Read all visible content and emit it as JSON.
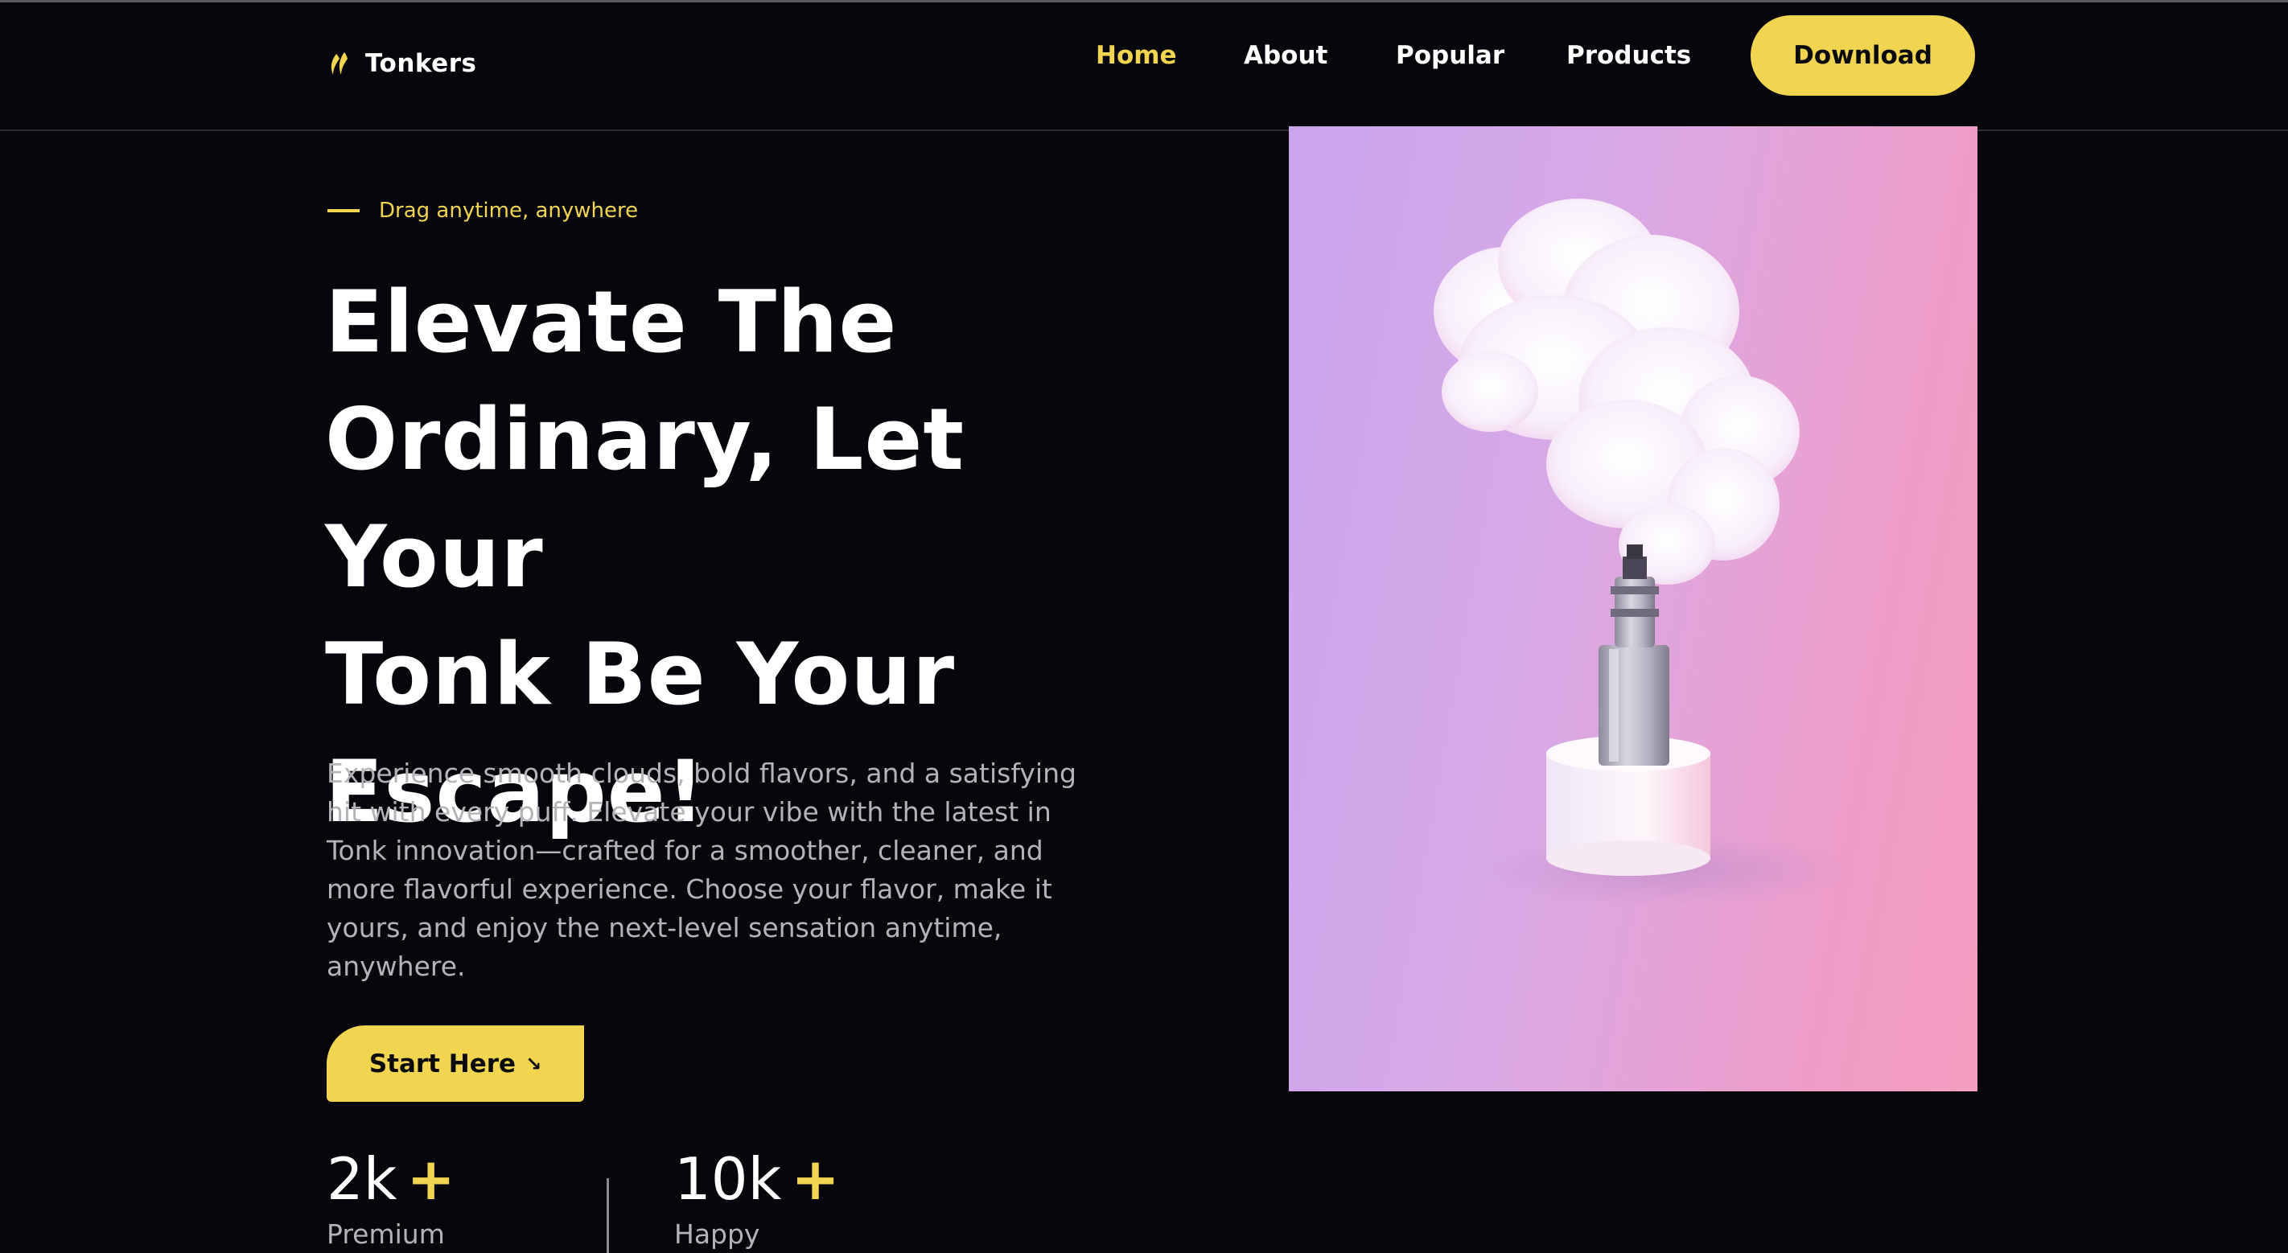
{
  "brand": {
    "name": "Tonkers",
    "icon": "flame-icon"
  },
  "nav": {
    "items": [
      {
        "label": "Home",
        "active": true
      },
      {
        "label": "About",
        "active": false
      },
      {
        "label": "Popular",
        "active": false
      },
      {
        "label": "Products",
        "active": false
      }
    ],
    "cta_label": "Download"
  },
  "hero": {
    "eyebrow": "Drag anytime, anywhere",
    "title_lines": [
      "Elevate The",
      "Ordinary, Let Your",
      "Tonk Be Your",
      "Escape!"
    ],
    "description": "Experience smooth clouds, bold flavors, and a satisfying hit with every puff. Elevate your vibe with the latest in Tonk innovation—crafted for a smoother, cleaner, and more flavorful experience. Choose your flavor, make it yours, and enjoy the next-level sensation anytime, anywhere.",
    "cta_label": "Start Here",
    "cta_icon": "arrow-down-right-icon",
    "image_alt": "vape device emitting a cloud on a white pedestal against a pink background"
  },
  "stats": [
    {
      "number": "2k",
      "plus": "+",
      "label": "Premium"
    },
    {
      "number": "10k",
      "plus": "+",
      "label": "Happy"
    }
  ],
  "colors": {
    "accent": "#f1d551",
    "background": "#06060c",
    "text": "#ffffff",
    "muted_text": "#b4b4b8"
  }
}
